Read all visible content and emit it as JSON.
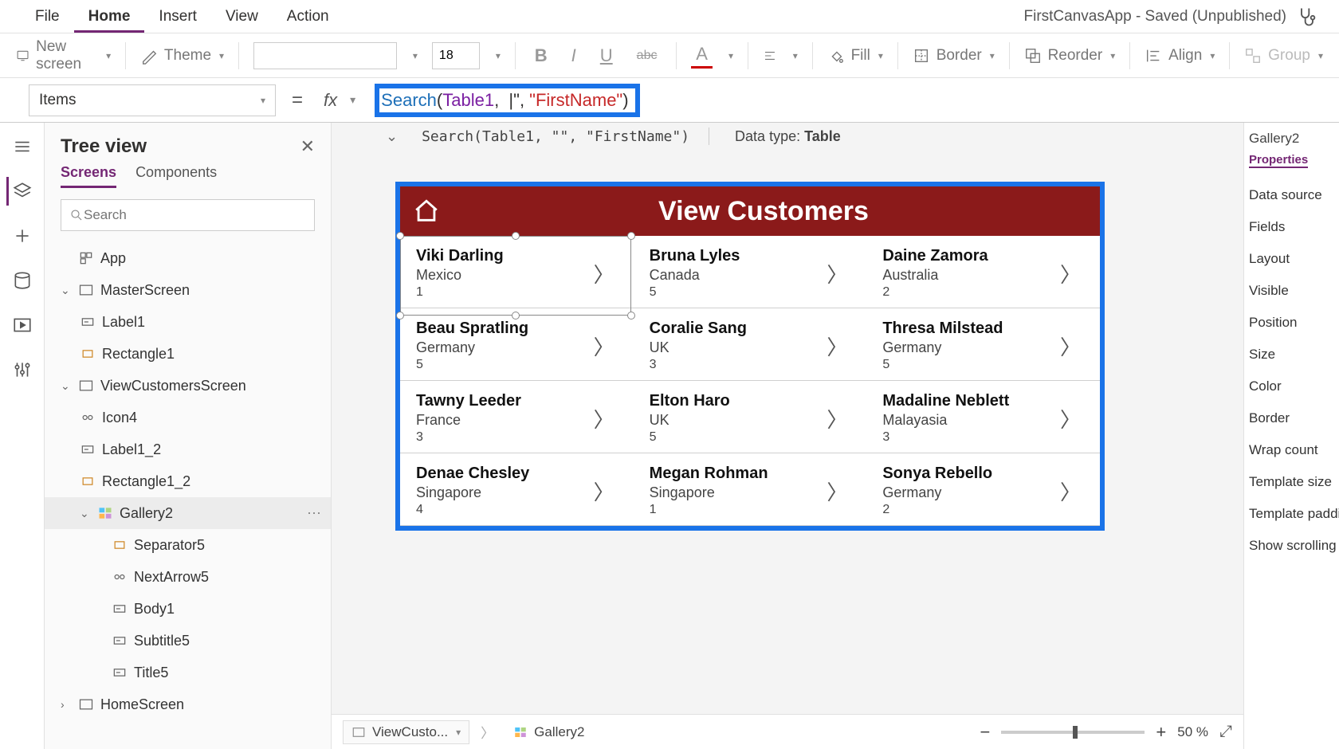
{
  "menu": {
    "file": "File",
    "home": "Home",
    "insert": "Insert",
    "view": "View",
    "action": "Action"
  },
  "doc_title": "FirstCanvasApp - Saved (Unpublished)",
  "ribbon": {
    "new_screen": "New screen",
    "theme": "Theme",
    "font_name": "",
    "font_size": "18",
    "fill": "Fill",
    "border": "Border",
    "reorder": "Reorder",
    "align": "Align",
    "group": "Group"
  },
  "property_selector": "Items",
  "formula": {
    "fn": "Search",
    "open": "(",
    "ds": "Table1",
    "comma1": ", ",
    "cursor_char": "|",
    "str_open": "\"",
    "str_close": "\"",
    "comma2": ", ",
    "arg2": "\"FirstName\"",
    "close": ")"
  },
  "hint_text": "Search(Table1, \"\", \"FirstName\")",
  "data_type_label": "Data type: ",
  "data_type_value": "Table",
  "tree": {
    "title": "Tree view",
    "tab_screens": "Screens",
    "tab_components": "Components",
    "search_placeholder": "Search",
    "items": {
      "app": "App",
      "master": "MasterScreen",
      "label1": "Label1",
      "rect1": "Rectangle1",
      "viewcust": "ViewCustomersScreen",
      "icon4": "Icon4",
      "label1_2": "Label1_2",
      "rect1_2": "Rectangle1_2",
      "gallery2": "Gallery2",
      "sep5": "Separator5",
      "next5": "NextArrow5",
      "body1": "Body1",
      "subtitle5": "Subtitle5",
      "title5": "Title5",
      "home": "HomeScreen"
    }
  },
  "app": {
    "header": "View Customers",
    "rows": [
      {
        "name": "Viki  Darling",
        "country": "Mexico",
        "num": "1"
      },
      {
        "name": "Bruna  Lyles",
        "country": "Canada",
        "num": "5"
      },
      {
        "name": "Daine  Zamora",
        "country": "Australia",
        "num": "2"
      },
      {
        "name": "Beau  Spratling",
        "country": "Germany",
        "num": "5"
      },
      {
        "name": "Coralie  Sang",
        "country": "UK",
        "num": "3"
      },
      {
        "name": "Thresa  Milstead",
        "country": "Germany",
        "num": "5"
      },
      {
        "name": "Tawny  Leeder",
        "country": "France",
        "num": "3"
      },
      {
        "name": "Elton  Haro",
        "country": "UK",
        "num": "5"
      },
      {
        "name": "Madaline  Neblett",
        "country": "Malayasia",
        "num": "3"
      },
      {
        "name": "Denae  Chesley",
        "country": "Singapore",
        "num": "4"
      },
      {
        "name": "Megan  Rohman",
        "country": "Singapore",
        "num": "1"
      },
      {
        "name": "Sonya  Rebello",
        "country": "Germany",
        "num": "2"
      }
    ]
  },
  "breadcrumb": {
    "screen": "ViewCusto...",
    "control": "Gallery2"
  },
  "zoom": "50  %",
  "right": {
    "title": "Gallery2",
    "tab": "Properties",
    "items": [
      "Data source",
      "Fields",
      "Layout",
      "Visible",
      "Position",
      "Size",
      "Color",
      "Border",
      "Wrap count",
      "Template size",
      "Template padding",
      "Show scrolling"
    ]
  }
}
